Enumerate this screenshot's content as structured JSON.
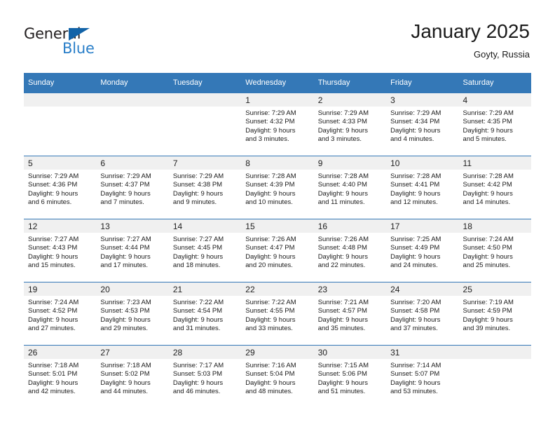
{
  "brand": {
    "word_one": "General",
    "word_two": "Blue",
    "triangle_color": "#1263a8",
    "blue_color": "#2a7fc9"
  },
  "header": {
    "title": "January 2025",
    "subtitle": "Goyty, Russia"
  },
  "theme": {
    "header_row_bg": "#3478b7",
    "daynum_band_bg": "#f0f0f0",
    "grid_line": "#3478b7",
    "text": "#1a1a1a"
  },
  "weekday_headers": [
    "Sunday",
    "Monday",
    "Tuesday",
    "Wednesday",
    "Thursday",
    "Friday",
    "Saturday"
  ],
  "weeks": [
    [
      {
        "day": "",
        "sunrise": "",
        "sunset": "",
        "daylight_a": "",
        "daylight_b": "",
        "empty": true
      },
      {
        "day": "",
        "sunrise": "",
        "sunset": "",
        "daylight_a": "",
        "daylight_b": "",
        "empty": true
      },
      {
        "day": "",
        "sunrise": "",
        "sunset": "",
        "daylight_a": "",
        "daylight_b": "",
        "empty": true
      },
      {
        "day": "1",
        "sunrise": "Sunrise: 7:29 AM",
        "sunset": "Sunset: 4:32 PM",
        "daylight_a": "Daylight: 9 hours",
        "daylight_b": "and 3 minutes.",
        "empty": false
      },
      {
        "day": "2",
        "sunrise": "Sunrise: 7:29 AM",
        "sunset": "Sunset: 4:33 PM",
        "daylight_a": "Daylight: 9 hours",
        "daylight_b": "and 3 minutes.",
        "empty": false
      },
      {
        "day": "3",
        "sunrise": "Sunrise: 7:29 AM",
        "sunset": "Sunset: 4:34 PM",
        "daylight_a": "Daylight: 9 hours",
        "daylight_b": "and 4 minutes.",
        "empty": false
      },
      {
        "day": "4",
        "sunrise": "Sunrise: 7:29 AM",
        "sunset": "Sunset: 4:35 PM",
        "daylight_a": "Daylight: 9 hours",
        "daylight_b": "and 5 minutes.",
        "empty": false
      }
    ],
    [
      {
        "day": "5",
        "sunrise": "Sunrise: 7:29 AM",
        "sunset": "Sunset: 4:36 PM",
        "daylight_a": "Daylight: 9 hours",
        "daylight_b": "and 6 minutes.",
        "empty": false
      },
      {
        "day": "6",
        "sunrise": "Sunrise: 7:29 AM",
        "sunset": "Sunset: 4:37 PM",
        "daylight_a": "Daylight: 9 hours",
        "daylight_b": "and 7 minutes.",
        "empty": false
      },
      {
        "day": "7",
        "sunrise": "Sunrise: 7:29 AM",
        "sunset": "Sunset: 4:38 PM",
        "daylight_a": "Daylight: 9 hours",
        "daylight_b": "and 9 minutes.",
        "empty": false
      },
      {
        "day": "8",
        "sunrise": "Sunrise: 7:28 AM",
        "sunset": "Sunset: 4:39 PM",
        "daylight_a": "Daylight: 9 hours",
        "daylight_b": "and 10 minutes.",
        "empty": false
      },
      {
        "day": "9",
        "sunrise": "Sunrise: 7:28 AM",
        "sunset": "Sunset: 4:40 PM",
        "daylight_a": "Daylight: 9 hours",
        "daylight_b": "and 11 minutes.",
        "empty": false
      },
      {
        "day": "10",
        "sunrise": "Sunrise: 7:28 AM",
        "sunset": "Sunset: 4:41 PM",
        "daylight_a": "Daylight: 9 hours",
        "daylight_b": "and 12 minutes.",
        "empty": false
      },
      {
        "day": "11",
        "sunrise": "Sunrise: 7:28 AM",
        "sunset": "Sunset: 4:42 PM",
        "daylight_a": "Daylight: 9 hours",
        "daylight_b": "and 14 minutes.",
        "empty": false
      }
    ],
    [
      {
        "day": "12",
        "sunrise": "Sunrise: 7:27 AM",
        "sunset": "Sunset: 4:43 PM",
        "daylight_a": "Daylight: 9 hours",
        "daylight_b": "and 15 minutes.",
        "empty": false
      },
      {
        "day": "13",
        "sunrise": "Sunrise: 7:27 AM",
        "sunset": "Sunset: 4:44 PM",
        "daylight_a": "Daylight: 9 hours",
        "daylight_b": "and 17 minutes.",
        "empty": false
      },
      {
        "day": "14",
        "sunrise": "Sunrise: 7:27 AM",
        "sunset": "Sunset: 4:45 PM",
        "daylight_a": "Daylight: 9 hours",
        "daylight_b": "and 18 minutes.",
        "empty": false
      },
      {
        "day": "15",
        "sunrise": "Sunrise: 7:26 AM",
        "sunset": "Sunset: 4:47 PM",
        "daylight_a": "Daylight: 9 hours",
        "daylight_b": "and 20 minutes.",
        "empty": false
      },
      {
        "day": "16",
        "sunrise": "Sunrise: 7:26 AM",
        "sunset": "Sunset: 4:48 PM",
        "daylight_a": "Daylight: 9 hours",
        "daylight_b": "and 22 minutes.",
        "empty": false
      },
      {
        "day": "17",
        "sunrise": "Sunrise: 7:25 AM",
        "sunset": "Sunset: 4:49 PM",
        "daylight_a": "Daylight: 9 hours",
        "daylight_b": "and 24 minutes.",
        "empty": false
      },
      {
        "day": "18",
        "sunrise": "Sunrise: 7:24 AM",
        "sunset": "Sunset: 4:50 PM",
        "daylight_a": "Daylight: 9 hours",
        "daylight_b": "and 25 minutes.",
        "empty": false
      }
    ],
    [
      {
        "day": "19",
        "sunrise": "Sunrise: 7:24 AM",
        "sunset": "Sunset: 4:52 PM",
        "daylight_a": "Daylight: 9 hours",
        "daylight_b": "and 27 minutes.",
        "empty": false
      },
      {
        "day": "20",
        "sunrise": "Sunrise: 7:23 AM",
        "sunset": "Sunset: 4:53 PM",
        "daylight_a": "Daylight: 9 hours",
        "daylight_b": "and 29 minutes.",
        "empty": false
      },
      {
        "day": "21",
        "sunrise": "Sunrise: 7:22 AM",
        "sunset": "Sunset: 4:54 PM",
        "daylight_a": "Daylight: 9 hours",
        "daylight_b": "and 31 minutes.",
        "empty": false
      },
      {
        "day": "22",
        "sunrise": "Sunrise: 7:22 AM",
        "sunset": "Sunset: 4:55 PM",
        "daylight_a": "Daylight: 9 hours",
        "daylight_b": "and 33 minutes.",
        "empty": false
      },
      {
        "day": "23",
        "sunrise": "Sunrise: 7:21 AM",
        "sunset": "Sunset: 4:57 PM",
        "daylight_a": "Daylight: 9 hours",
        "daylight_b": "and 35 minutes.",
        "empty": false
      },
      {
        "day": "24",
        "sunrise": "Sunrise: 7:20 AM",
        "sunset": "Sunset: 4:58 PM",
        "daylight_a": "Daylight: 9 hours",
        "daylight_b": "and 37 minutes.",
        "empty": false
      },
      {
        "day": "25",
        "sunrise": "Sunrise: 7:19 AM",
        "sunset": "Sunset: 4:59 PM",
        "daylight_a": "Daylight: 9 hours",
        "daylight_b": "and 39 minutes.",
        "empty": false
      }
    ],
    [
      {
        "day": "26",
        "sunrise": "Sunrise: 7:18 AM",
        "sunset": "Sunset: 5:01 PM",
        "daylight_a": "Daylight: 9 hours",
        "daylight_b": "and 42 minutes.",
        "empty": false
      },
      {
        "day": "27",
        "sunrise": "Sunrise: 7:18 AM",
        "sunset": "Sunset: 5:02 PM",
        "daylight_a": "Daylight: 9 hours",
        "daylight_b": "and 44 minutes.",
        "empty": false
      },
      {
        "day": "28",
        "sunrise": "Sunrise: 7:17 AM",
        "sunset": "Sunset: 5:03 PM",
        "daylight_a": "Daylight: 9 hours",
        "daylight_b": "and 46 minutes.",
        "empty": false
      },
      {
        "day": "29",
        "sunrise": "Sunrise: 7:16 AM",
        "sunset": "Sunset: 5:04 PM",
        "daylight_a": "Daylight: 9 hours",
        "daylight_b": "and 48 minutes.",
        "empty": false
      },
      {
        "day": "30",
        "sunrise": "Sunrise: 7:15 AM",
        "sunset": "Sunset: 5:06 PM",
        "daylight_a": "Daylight: 9 hours",
        "daylight_b": "and 51 minutes.",
        "empty": false
      },
      {
        "day": "31",
        "sunrise": "Sunrise: 7:14 AM",
        "sunset": "Sunset: 5:07 PM",
        "daylight_a": "Daylight: 9 hours",
        "daylight_b": "and 53 minutes.",
        "empty": false
      },
      {
        "day": "",
        "sunrise": "",
        "sunset": "",
        "daylight_a": "",
        "daylight_b": "",
        "empty": true
      }
    ]
  ]
}
